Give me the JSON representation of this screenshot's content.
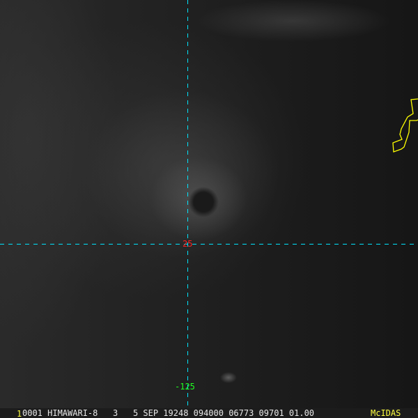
{
  "grid": {
    "latitude_label": "25",
    "longitude_label": "-125",
    "line_color": "#00e5ff"
  },
  "status_bar": {
    "frame_index": "1",
    "info": "0001 HIMAWARI-8   3   5 SEP 19248 094000 06773 09701 01.00",
    "logo": "McIDAS"
  },
  "colors": {
    "coastline": "#ffff00",
    "lat_label": "#ff2020",
    "lon_label": "#20ff20"
  }
}
